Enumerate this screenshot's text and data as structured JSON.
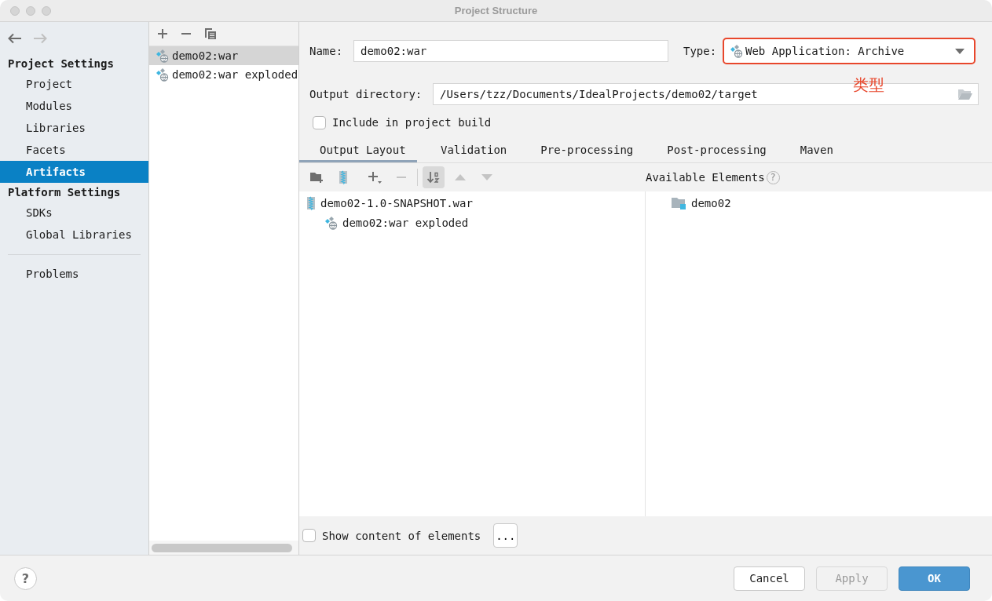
{
  "window": {
    "title": "Project Structure"
  },
  "nav": {
    "back_disabled": false,
    "forward_disabled": true
  },
  "sidebar": {
    "sections": [
      {
        "title": "Project Settings",
        "items": [
          {
            "label": "Project",
            "selected": false
          },
          {
            "label": "Modules",
            "selected": false
          },
          {
            "label": "Libraries",
            "selected": false
          },
          {
            "label": "Facets",
            "selected": false
          },
          {
            "label": "Artifacts",
            "selected": true
          }
        ]
      },
      {
        "title": "Platform Settings",
        "items": [
          {
            "label": "SDKs",
            "selected": false
          },
          {
            "label": "Global Libraries",
            "selected": false
          }
        ]
      }
    ],
    "extra_items": [
      {
        "label": "Problems",
        "selected": false
      }
    ]
  },
  "artifacts": {
    "items": [
      {
        "label": "demo02:war",
        "selected": true
      },
      {
        "label": "demo02:war exploded",
        "selected": false
      }
    ]
  },
  "editor": {
    "name_label": "Name:",
    "name_value": "demo02:war",
    "type_label": "Type:",
    "type_value": "Web Application: Archive",
    "type_highlighted": true,
    "annotation": "类型",
    "output_label": "Output directory:",
    "output_value": "/Users/tzz/Documents/IdealProjects/demo02/target",
    "include_build": {
      "label": "Include in project build",
      "checked": false
    },
    "tabs": [
      {
        "label": "Output Layout",
        "selected": true
      },
      {
        "label": "Validation",
        "selected": false
      },
      {
        "label": "Pre-processing",
        "selected": false
      },
      {
        "label": "Post-processing",
        "selected": false
      },
      {
        "label": "Maven",
        "selected": false
      }
    ],
    "toolbar": [
      {
        "kind": "new-folder",
        "disabled": false,
        "selected": false
      },
      {
        "kind": "archive",
        "disabled": false,
        "selected": false
      },
      {
        "kind": "add",
        "disabled": false,
        "selected": false
      },
      {
        "kind": "remove",
        "disabled": true,
        "selected": false
      },
      {
        "kind": "sort",
        "disabled": false,
        "selected": true
      },
      {
        "kind": "up",
        "disabled": true,
        "selected": false
      },
      {
        "kind": "down",
        "disabled": true,
        "selected": false
      }
    ],
    "available_title": "Available Elements",
    "available_help": "?",
    "layout_tree": [
      {
        "label": "demo02-1.0-SNAPSHOT.war",
        "kind": "archive",
        "children": [
          {
            "label": "demo02:war exploded",
            "kind": "artifact"
          }
        ]
      }
    ],
    "available_tree": [
      {
        "label": "demo02",
        "kind": "module"
      }
    ],
    "show_content": {
      "label": "Show content of elements",
      "checked": false
    },
    "more_button": "..."
  },
  "footer": {
    "help": "?",
    "buttons": [
      {
        "label": "Cancel",
        "kind": "normal"
      },
      {
        "label": "Apply",
        "kind": "disabled"
      },
      {
        "label": "OK",
        "kind": "default"
      }
    ]
  }
}
